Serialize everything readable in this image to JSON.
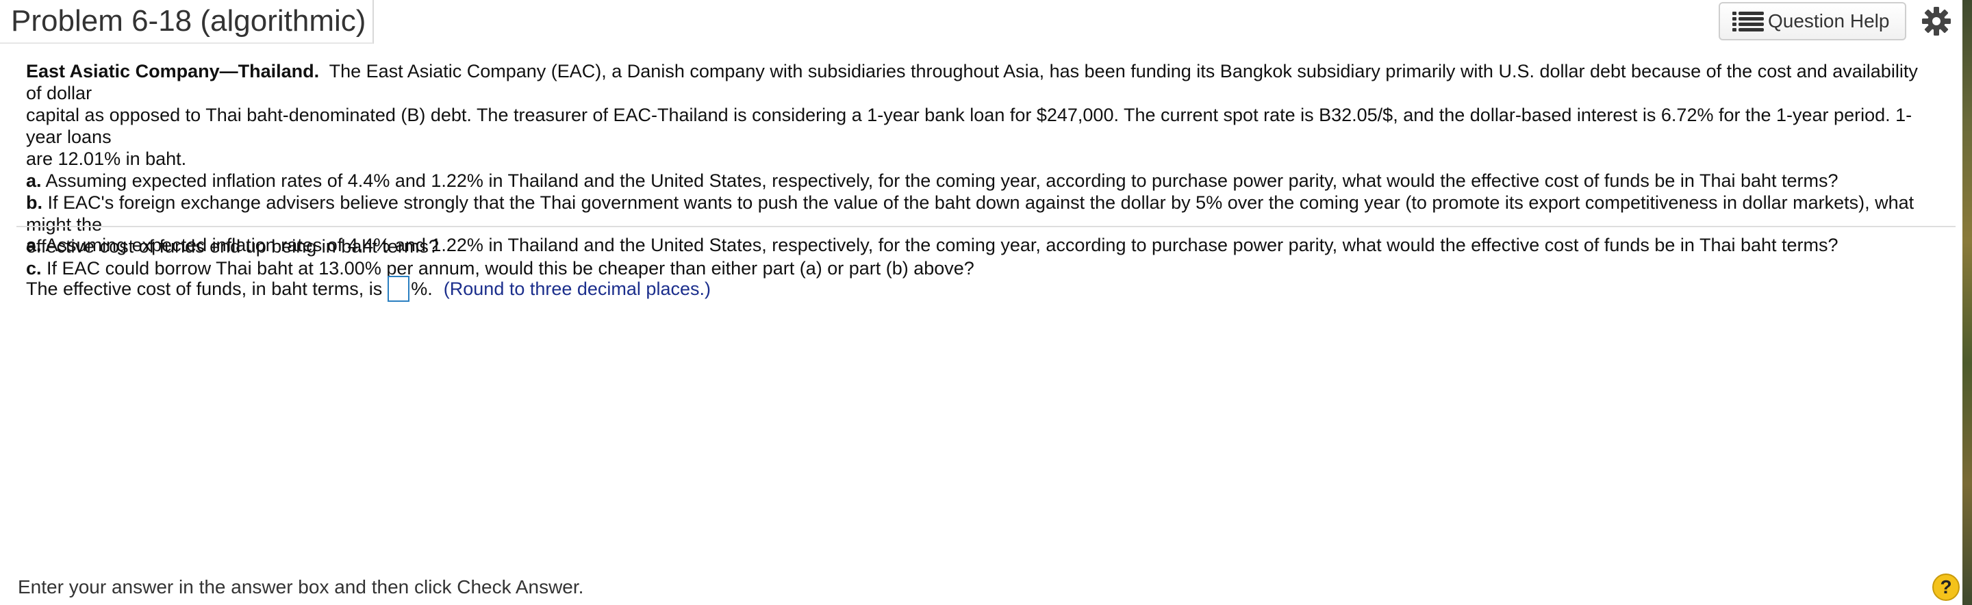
{
  "header": {
    "title": "Problem 6-18 (algorithmic)",
    "question_help_label": "Question Help",
    "question_help_icon": "list-icon",
    "settings_icon": "gear-icon"
  },
  "problem": {
    "lead": "East Asiatic Company—Thailand.",
    "line1": "The East Asiatic Company (EAC), a Danish company with subsidiaries throughout Asia, has been funding its Bangkok subsidiary primarily with U.S. dollar debt because of the cost and availability of dollar",
    "line2": "capital as opposed to Thai baht-denominated (B) debt. The treasurer of EAC-Thailand is considering a 1-year bank loan for $247,000. The current spot rate is B32.05/$, and the dollar-based interest is 6.72% for the 1-year period.  1-year loans",
    "line3": "are 12.01% in baht.",
    "part_a_label": "a.",
    "part_a_text": "Assuming expected inflation rates of 4.4% and 1.22% in Thailand and the United States, respectively, for the coming year, according to purchase power parity, what would the effective cost of funds be in Thai baht terms?",
    "part_b_label": "b.",
    "part_b_text1": "If EAC's foreign exchange advisers believe strongly that the Thai government wants to push the value of the baht down against the dollar by 5% over the coming year (to promote its export competitiveness in dollar markets), what might the",
    "part_b_text2": "effective cost of funds end up being in baht terms?",
    "part_c_label": "c.",
    "part_c_text": "If EAC could borrow Thai baht at 13.00% per annum, would this be cheaper than either part (a) or part (b) above?"
  },
  "current_question": {
    "label": "a.",
    "text": "Assuming expected inflation rates of 4.4% and 1.22% in Thailand and the United States, respectively, for the coming year, according to purchase power parity, what would the effective cost of funds be in Thai baht terms?"
  },
  "answer": {
    "prefix": "The effective cost of funds, in baht terms, is",
    "value": "",
    "suffix": "%.",
    "hint": "(Round to three decimal places.)"
  },
  "footer": {
    "instruction": "Enter your answer in the answer box and then click Check Answer.",
    "help_label": "?"
  },
  "colors": {
    "hint": "#1b2e8c",
    "answer_box_border": "#2a7fc1",
    "help_circle": "#f4c21b"
  }
}
